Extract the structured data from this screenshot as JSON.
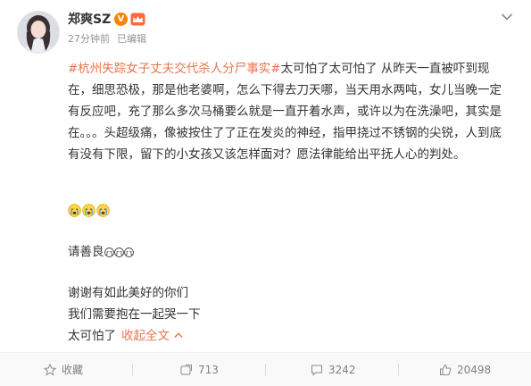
{
  "author": {
    "name": "郑爽SZ",
    "badge_text": "V"
  },
  "meta": {
    "time": "27分钟前",
    "edited": "已编辑"
  },
  "post": {
    "hashtag": "#杭州失踪女子丈夫交代杀人分尸事实#",
    "body": "太可怕了太可怕了 从昨天一直被吓到现在，细思恐极，那是他老婆啊，怎么下得去刀天哪，当天用水两吨，女儿当晚一定有反应吧，充了那么多次马桶要么就是一直开着水声，或许以为在洗澡吧，其实是在。。。头超级痛，像被按住了了正在发炎的神经，指甲挠过不锈钢的尖锐，人到底有没有下限，留下的小女孩又该怎样面对？愿法律能给出平抚人心的判处。",
    "line_kind": "请善良",
    "line_thanks": "谢谢有如此美好的你们",
    "line_hug": "我们需要抱在一起哭一下",
    "line_scary": "太可怕了",
    "collapse_label": "收起全文"
  },
  "actions": {
    "favorite_label": "收藏",
    "repost_count": "713",
    "comment_count": "3242",
    "like_count": "20498"
  },
  "colors": {
    "hashtag": "#eb7350",
    "badge": "#ff8200",
    "meta": "#939393"
  },
  "icons": [
    "chevron-down-icon",
    "verified-icon",
    "crown-icon",
    "crying-emoji-icon",
    "star-icon",
    "repost-icon",
    "comment-icon",
    "like-icon",
    "chevron-up-icon"
  ]
}
